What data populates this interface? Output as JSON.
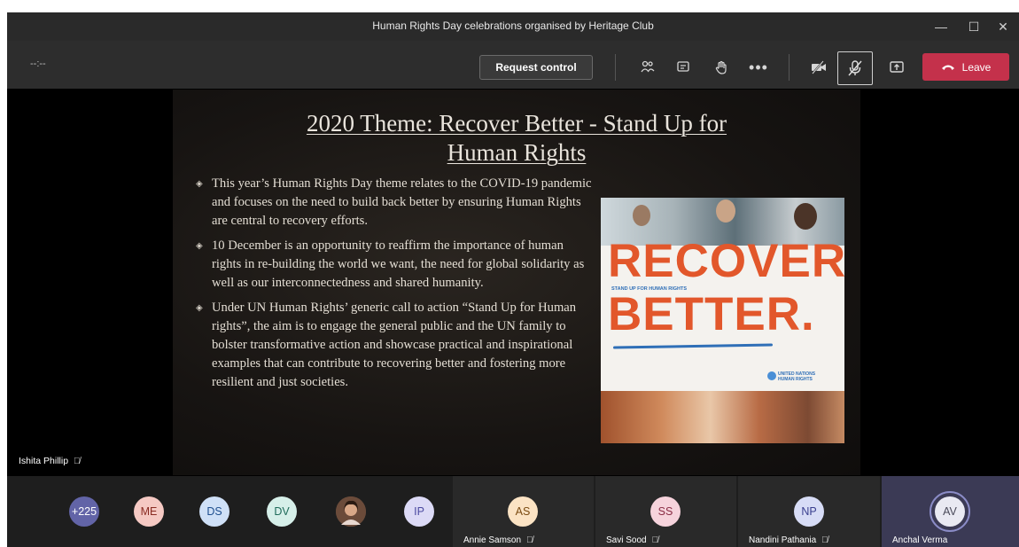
{
  "window": {
    "title": "Human Rights Day celebrations organised by Heritage Club",
    "minimize": "—",
    "maximize": "☐",
    "close": "✕"
  },
  "toolbar": {
    "timer": "--:--",
    "request_control": "Request control",
    "leave": "Leave",
    "icons": [
      "participants-icon",
      "chat-icon",
      "raise-hand-icon",
      "more-options-icon",
      "camera-off-icon",
      "mic-off-icon",
      "share-screen-icon"
    ]
  },
  "slide": {
    "title_line1": "2020 Theme: Recover Better - Stand Up for",
    "title_line2": "Human Rights",
    "bullets": [
      "This year’s Human Rights Day theme relates to the COVID-19 pandemic and focuses on the need to build back better by ensuring Human Rights are central to recovery efforts.",
      "10 December is an opportunity to reaffirm the importance of human rights in re-building the world we want, the need for global solidarity as well as our interconnectedness and shared humanity.",
      "Under UN Human Rights’ generic call to action “Stand Up for Human rights”, the aim is to engage the general public and the UN family to bolster transformative action and showcase practical and inspirational examples that can contribute to recovering better and fostering more resilient and just societies."
    ],
    "poster": {
      "word1": "RECOVER",
      "word2": "BETTER.",
      "tagline": "STAND UP FOR HUMAN RIGHTS",
      "logo_line1": "UNITED NATIONS",
      "logo_line2": "HUMAN RIGHTS"
    }
  },
  "presenter": {
    "name": "Ishita Phillip"
  },
  "participants": {
    "overflow": "+225",
    "avatars": [
      {
        "initials": "ME",
        "bg": "#f5c9c3",
        "fg": "#8a2c23"
      },
      {
        "initials": "DS",
        "bg": "#cfe0f7",
        "fg": "#1f4f8f"
      },
      {
        "initials": "DV",
        "bg": "#d6efe9",
        "fg": "#1f6b5a"
      },
      {
        "initials": "",
        "bg": "#7a5a48",
        "fg": "#ffffff"
      },
      {
        "initials": "IP",
        "bg": "#dcdaf6",
        "fg": "#4b4aa0"
      }
    ],
    "tiles": [
      {
        "initials": "AS",
        "name": "Annie Samson",
        "bg": "#fbe3c4",
        "fg": "#7a4a10"
      },
      {
        "initials": "SS",
        "name": "Savi Sood",
        "bg": "#f6d3dc",
        "fg": "#8a2c45"
      },
      {
        "initials": "NP",
        "name": "Nandini Pathania",
        "bg": "#d7dcf6",
        "fg": "#3a3f8f"
      },
      {
        "initials": "AV",
        "name": "Anchal Verma",
        "bg": "#e9e9f2",
        "fg": "#4a4a5a"
      }
    ]
  },
  "colors": {
    "leave": "#c4314b",
    "overflow_badge": "#6264a7"
  }
}
